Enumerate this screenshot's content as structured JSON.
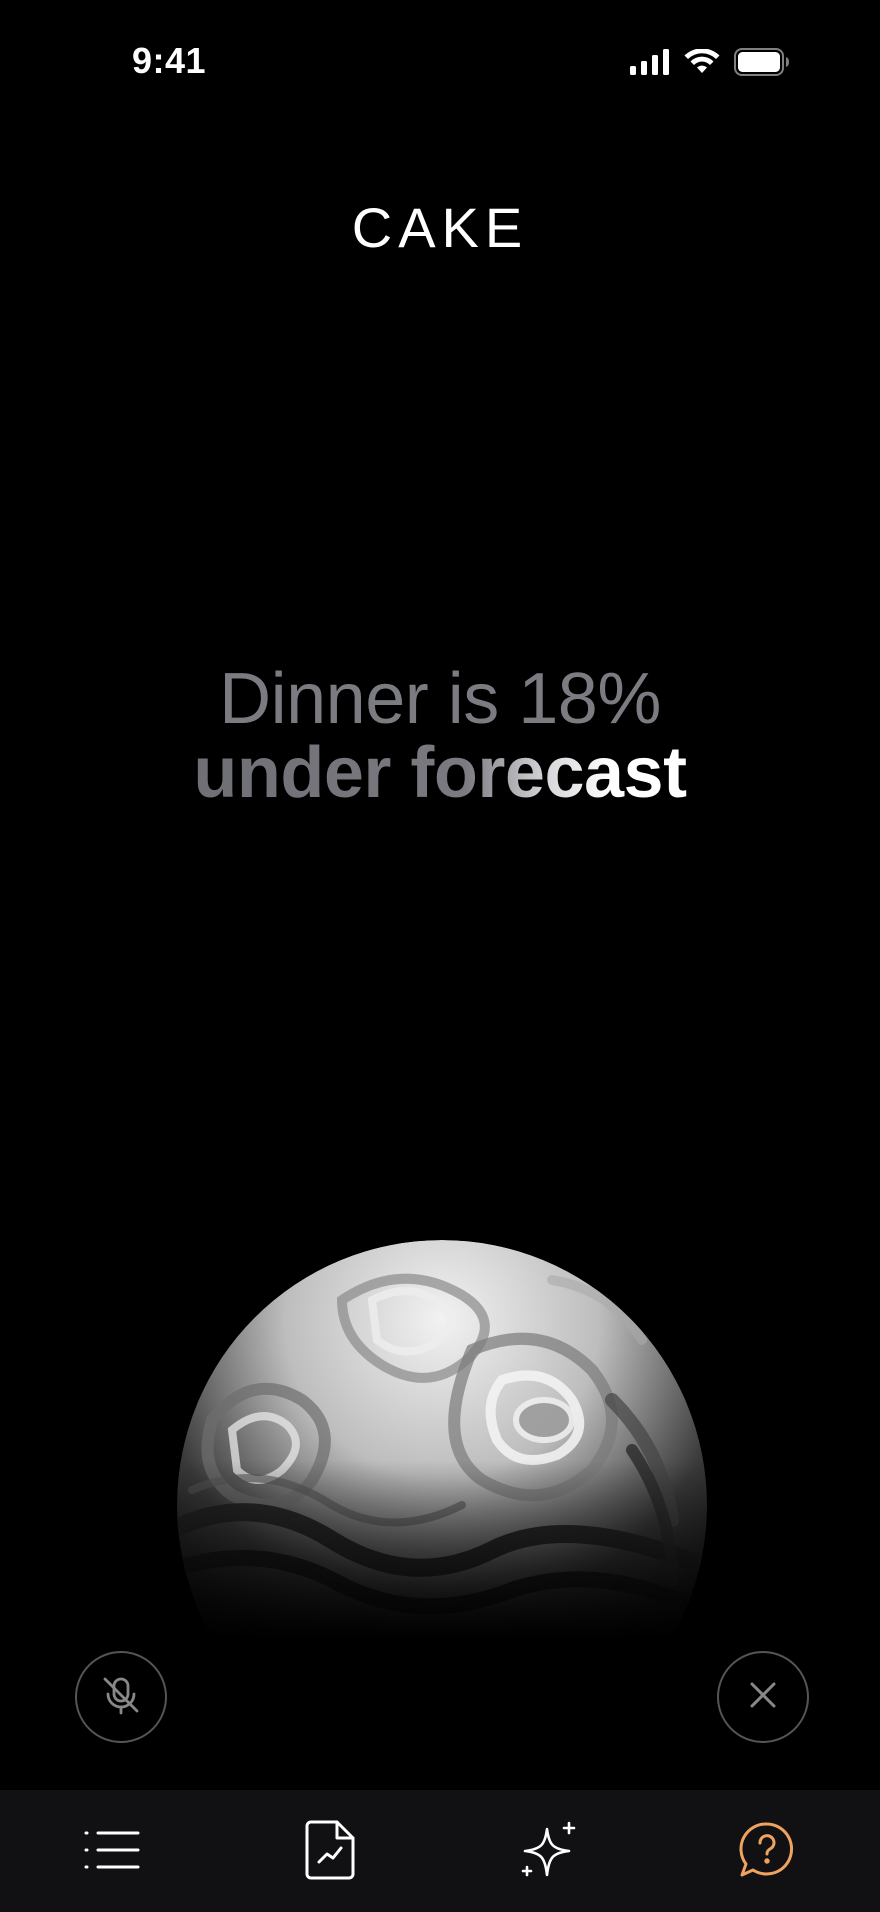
{
  "status_bar": {
    "time": "9:41",
    "icons": [
      "signal-icon",
      "wifi-icon",
      "battery-icon"
    ]
  },
  "brand": {
    "logo_text": "CAKE"
  },
  "insight": {
    "line1": "Dinner is 18%",
    "line2": "under forecast"
  },
  "controls": {
    "mute_icon": "microphone-off-icon",
    "close_icon": "close-icon"
  },
  "tab_bar": {
    "tabs": [
      {
        "icon": "list-icon",
        "active": false
      },
      {
        "icon": "report-chart-icon",
        "active": false
      },
      {
        "icon": "sparkle-icon",
        "active": false
      },
      {
        "icon": "help-chat-icon",
        "active": true
      }
    ],
    "active_color": "#F0A35E"
  },
  "colors": {
    "background": "#000000",
    "headline_muted": "#7B7B82",
    "tab_bar_bg": "#111113",
    "accent": "#F0A35E"
  }
}
